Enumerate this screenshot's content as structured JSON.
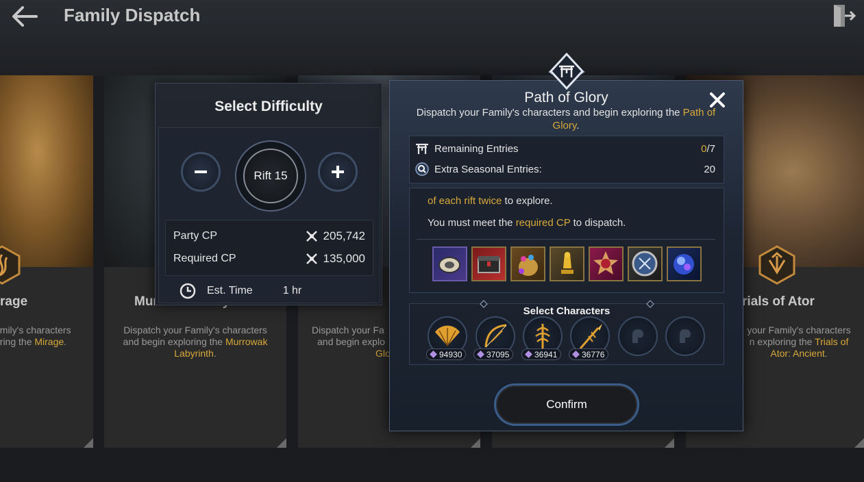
{
  "header": {
    "title": "Family Dispatch",
    "back_icon": "back-arrow-icon",
    "exit_icon": "exit-door-icon"
  },
  "cards": [
    {
      "title": "rage",
      "desc_parts": [
        "amily's characters",
        "oring the ",
        "Mirage",
        "."
      ]
    },
    {
      "title": "Murrowak Labyrinth",
      "desc_line1": "Dispatch your Family's characters",
      "desc_line2": "and begin exploring the ",
      "desc_gold1": "Murrowak",
      "desc_gold2": "Labyrinth",
      "desc_end": "."
    },
    {
      "title": "",
      "desc_line1": "Dispatch your Fa",
      "desc_line2": "and begin explo",
      "desc_gold": "Glo"
    },
    {
      "title": ""
    },
    {
      "title": "rials of Ator",
      "desc_line1": "your Family's characters",
      "desc_line2": "n exploring the ",
      "desc_gold1": "Trials of",
      "desc_gold2": "Ator: Ancient",
      "desc_end": "."
    }
  ],
  "difficulty": {
    "title": "Select Difficulty",
    "minus_label": "−",
    "plus_label": "+",
    "rift_label": "Rift 15",
    "party_cp_label": "Party CP",
    "party_cp_value": "205,742",
    "required_cp_label": "Required CP",
    "required_cp_value": "135,000",
    "est_time_label": "Est. Time",
    "est_time_value": "1 hr"
  },
  "modal": {
    "title": "Path of Glory",
    "desc_text": "Dispatch your Family's characters and begin exploring the ",
    "desc_gold": "Path of Glory",
    "desc_end": ".",
    "remaining_label": "Remaining Entries",
    "remaining_used": "0",
    "remaining_total": "/7",
    "extra_label": "Extra Seasonal Entries:",
    "extra_value": "20",
    "detail_line1_gold": "of each rift twice",
    "detail_line1_rest": " to explore.",
    "detail_line2_pre": "You must meet the ",
    "detail_line2_gold": "required CP",
    "detail_line2_end": " to dispatch.",
    "rewards": [
      "coin-medal-icon",
      "treasure-chest-icon",
      "gem-pouch-icon",
      "golden-trophy-icon",
      "crimson-medal-icon",
      "blue-emblem-icon",
      "blue-orb-icon"
    ],
    "select_characters_label": "Select Characters",
    "characters": [
      {
        "icon": "fan-weapon-icon",
        "cp": "94930"
      },
      {
        "icon": "bow-weapon-icon",
        "cp": "37095"
      },
      {
        "icon": "staff-weapon-icon",
        "cp": "36941"
      },
      {
        "icon": "spear-weapon-icon",
        "cp": "36776"
      },
      {
        "icon": "empty-slot-helmet-icon",
        "cp": ""
      },
      {
        "icon": "empty-slot-helmet-icon",
        "cp": ""
      }
    ],
    "confirm_label": "Confirm"
  },
  "colors": {
    "gold": "#d8a93a",
    "accent_blue": "#3c5d8a"
  }
}
